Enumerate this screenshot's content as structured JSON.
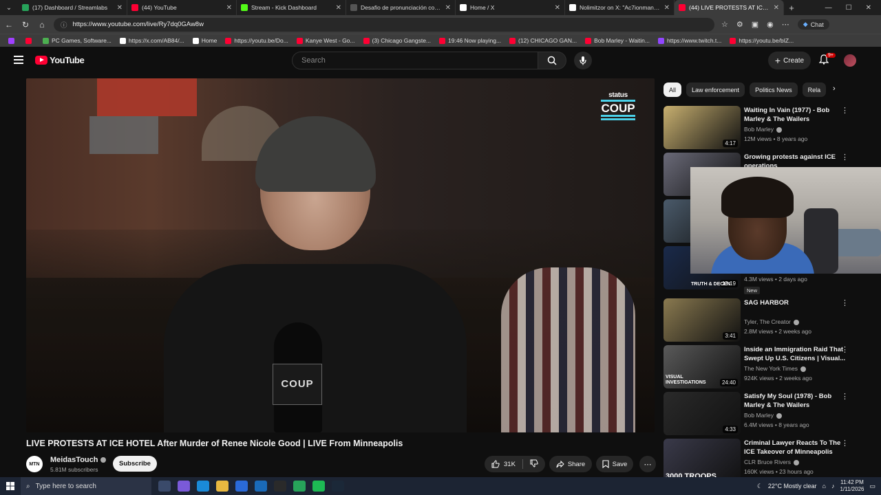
{
  "browser": {
    "tabs": [
      {
        "title": "(17) Dashboard / Streamlabs",
        "color": "#27a35a"
      },
      {
        "title": "(44) YouTube",
        "color": "#ff0033"
      },
      {
        "title": "Stream - Kick Dashboard",
        "color": "#53fc18"
      },
      {
        "title": "Desafio de pronunciación con ac",
        "color": "#555555"
      },
      {
        "title": "Home / X",
        "color": "#ffffff"
      },
      {
        "title": "Nolimitzor on X: \"Ac7ionman's c",
        "color": "#ffffff"
      },
      {
        "title": "(44) LIVE PROTESTS AT ICE H",
        "color": "#ff0033",
        "active": true
      }
    ],
    "url": "https://www.youtube.com/live/Ry7dq0GAw8w",
    "chat_label": "Chat",
    "bookmarks": [
      {
        "label": "",
        "color": "#a040ff"
      },
      {
        "label": "",
        "color": "#ff0033"
      },
      {
        "label": "PC Games, Software...",
        "color": "#4caf50"
      },
      {
        "label": "https://x.com/AB84/...",
        "color": "#ffffff"
      },
      {
        "label": "Home",
        "color": "#ffffff"
      },
      {
        "label": "https://youtu.be/Do...",
        "color": "#ff0033"
      },
      {
        "label": "Kanye West - Go...",
        "color": "#ff0033"
      },
      {
        "label": "(3) Chicago Gangste...",
        "color": "#ff0033"
      },
      {
        "label": "19:46 Now playing...",
        "color": "#ff0033"
      },
      {
        "label": "(12) CHICAGO GAN...",
        "color": "#ff0033"
      },
      {
        "label": "Bob Marley - Waitin...",
        "color": "#ff0033"
      },
      {
        "label": "https://www.twitch.t...",
        "color": "#9146ff"
      },
      {
        "label": "https://youtu.be/bIZ...",
        "color": "#ff0033"
      }
    ]
  },
  "youtube": {
    "logo_text": "YouTube",
    "search_placeholder": "Search",
    "create_label": "Create",
    "notification_count": "9+",
    "video": {
      "overlay_brand_top": "status",
      "overlay_brand_bottom": "COUP",
      "mic_flag": "COUP",
      "title": "LIVE PROTESTS AT ICE HOTEL After Murder of Renee Nicole Good | LIVE From Minneapolis",
      "channel_avatar_text": "MTN",
      "channel": "MeidasTouch",
      "subscribers": "5.81M subscribers",
      "subscribe_label": "Subscribe",
      "likes": "31K",
      "share_label": "Share",
      "save_label": "Save"
    },
    "chips": [
      "All",
      "Law enforcement",
      "Politics News",
      "Rela"
    ],
    "recommendations": [
      {
        "title": "Waiting In Vain (1977) - Bob Marley & The Wailers",
        "channel": "Bob Marley",
        "meta": "12M views • 8 years ago",
        "duration": "4:17",
        "thumb": "#c8b070"
      },
      {
        "title": "Growing protests against ICE operations",
        "channel": "",
        "meta": "",
        "duration": "",
        "thumb": "#6a6a78"
      },
      {
        "title": "",
        "channel": "",
        "meta": "",
        "duration": "",
        "thumb": "#4a5a6a"
      },
      {
        "title": "",
        "channel": "",
        "meta": "4.3M views • 2 days ago",
        "duration": "13:19",
        "thumb": "#1a2a4a"
      },
      {
        "title": "SAG HARBOR",
        "channel": "Tyler, The Creator",
        "meta": "2.8M views • 2 weeks ago",
        "duration": "3:41",
        "thumb": "#8a7a50"
      },
      {
        "title": "Inside an Immigration Raid That Swept Up U.S. Citizens | Visual...",
        "channel": "The New York Times",
        "meta": "924K views • 2 weeks ago",
        "duration": "24:40",
        "thumb": "#5a5a5a"
      },
      {
        "title": "Satisfy My Soul (1978) - Bob Marley & The Wailers",
        "channel": "Bob Marley",
        "meta": "6.4M views • 8 years ago",
        "duration": "4:33",
        "thumb": "#2a2a2a"
      },
      {
        "title": "Criminal Lawyer Reacts To The ICE Takeover of Minneapolis",
        "channel": "CLR Bruce Rivers",
        "meta": "160K views • 23 hours ago",
        "duration": "",
        "thumb": "#3a3a4a"
      }
    ],
    "rec4_thumb_label": "TRUTH & DECEN",
    "new_badge": "New",
    "rec6_thumb_label": "VISUAL INVESTIGATIONS",
    "rec8_thumb_label": "3000 TROOPS"
  },
  "taskbar": {
    "search_placeholder": "Type here to search",
    "weather": "22°C  Mostly clear",
    "time": "11:42 PM",
    "date": "1/11/2026"
  }
}
